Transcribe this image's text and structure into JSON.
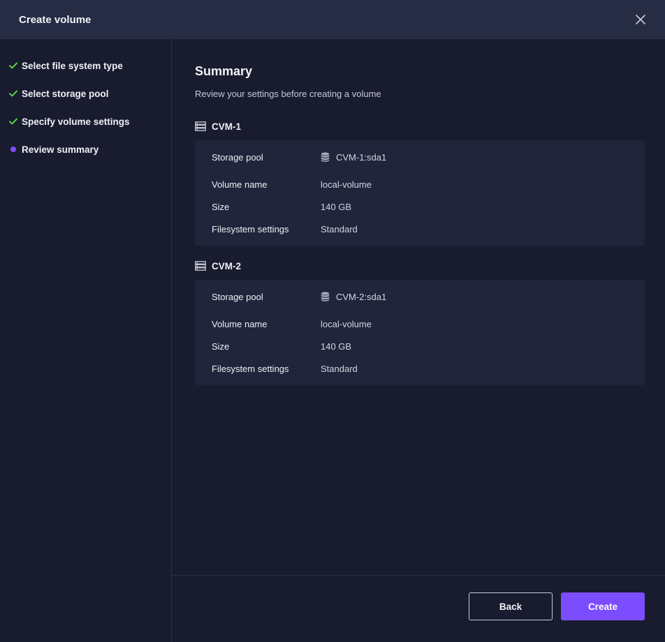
{
  "header": {
    "title": "Create volume"
  },
  "steps": [
    {
      "label": "Select file system type",
      "state": "done"
    },
    {
      "label": "Select storage pool",
      "state": "done"
    },
    {
      "label": "Specify volume settings",
      "state": "done"
    },
    {
      "label": "Review summary",
      "state": "current"
    }
  ],
  "summary": {
    "title": "Summary",
    "subtitle": "Review your settings before creating a volume"
  },
  "field_labels": {
    "storage_pool": "Storage pool",
    "volume_name": "Volume name",
    "size": "Size",
    "filesystem_settings": "Filesystem settings"
  },
  "cvms": [
    {
      "name": "CVM-1",
      "storage_pool": "CVM-1:sda1",
      "volume_name": "local-volume",
      "size": "140 GB",
      "filesystem_settings": "Standard"
    },
    {
      "name": "CVM-2",
      "storage_pool": "CVM-2:sda1",
      "volume_name": "local-volume",
      "size": "140 GB",
      "filesystem_settings": "Standard"
    }
  ],
  "footer": {
    "back_label": "Back",
    "create_label": "Create"
  },
  "colors": {
    "accent": "#7c4dff",
    "check": "#5ccf4a"
  },
  "icons": {
    "close": "close-icon",
    "check": "check-icon",
    "server": "server-icon",
    "database": "database-icon"
  }
}
